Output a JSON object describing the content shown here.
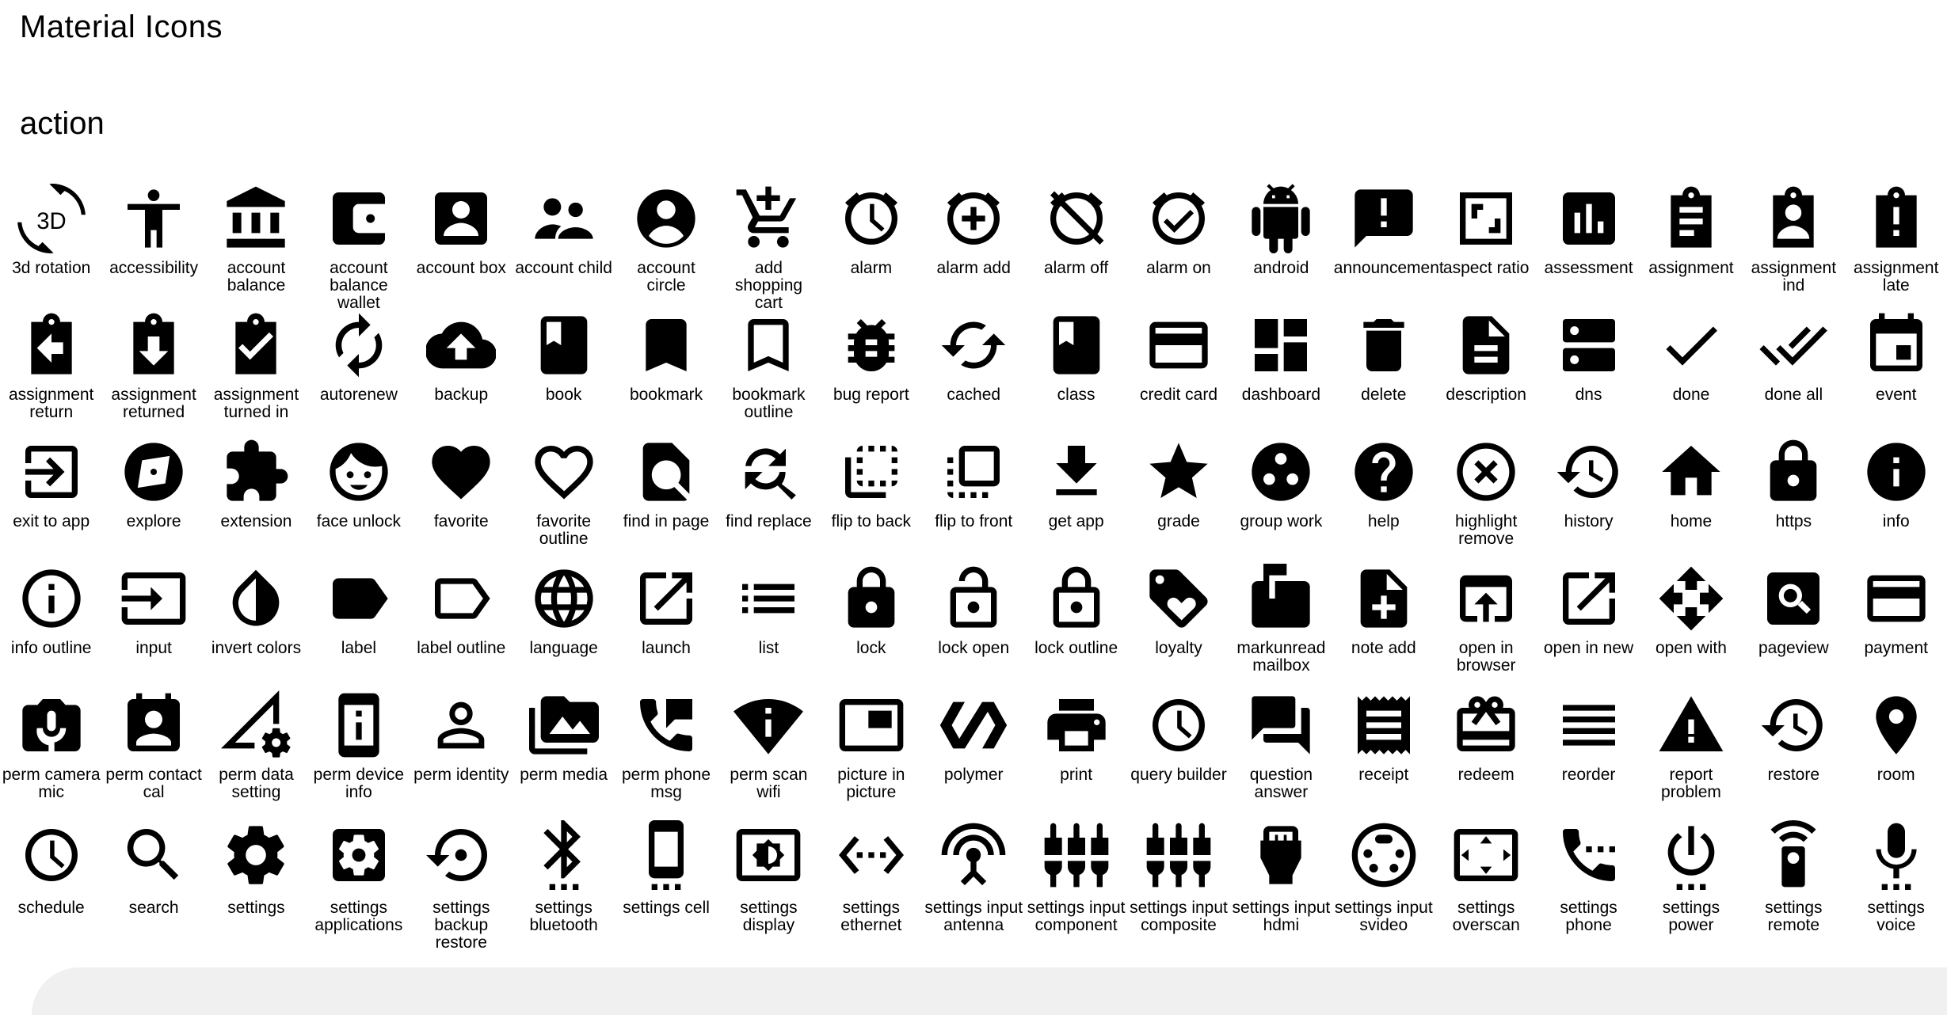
{
  "page_title": "Material Icons",
  "section": {
    "title": "action",
    "icons": [
      {
        "name": "3d rotation",
        "icon": "3d-rotation-icon"
      },
      {
        "name": "accessibility",
        "icon": "accessibility-icon"
      },
      {
        "name": "account balance",
        "icon": "account-balance-icon"
      },
      {
        "name": "account balance wallet",
        "icon": "account-balance-wallet-icon"
      },
      {
        "name": "account box",
        "icon": "account-box-icon"
      },
      {
        "name": "account child",
        "icon": "account-child-icon"
      },
      {
        "name": "account circle",
        "icon": "account-circle-icon"
      },
      {
        "name": "add shopping cart",
        "icon": "add-shopping-cart-icon"
      },
      {
        "name": "alarm",
        "icon": "alarm-icon"
      },
      {
        "name": "alarm add",
        "icon": "alarm-add-icon"
      },
      {
        "name": "alarm off",
        "icon": "alarm-off-icon"
      },
      {
        "name": "alarm on",
        "icon": "alarm-on-icon"
      },
      {
        "name": "android",
        "icon": "android-icon"
      },
      {
        "name": "announcement",
        "icon": "announcement-icon"
      },
      {
        "name": "aspect ratio",
        "icon": "aspect-ratio-icon"
      },
      {
        "name": "assessment",
        "icon": "assessment-icon"
      },
      {
        "name": "assignment",
        "icon": "assignment-icon"
      },
      {
        "name": "assignment ind",
        "icon": "assignment-ind-icon"
      },
      {
        "name": "assignment late",
        "icon": "assignment-late-icon"
      },
      {
        "name": "assignment return",
        "icon": "assignment-return-icon"
      },
      {
        "name": "assignment returned",
        "icon": "assignment-returned-icon"
      },
      {
        "name": "assignment turned in",
        "icon": "assignment-turned-in-icon"
      },
      {
        "name": "autorenew",
        "icon": "autorenew-icon"
      },
      {
        "name": "backup",
        "icon": "backup-icon"
      },
      {
        "name": "book",
        "icon": "book-icon"
      },
      {
        "name": "bookmark",
        "icon": "bookmark-icon"
      },
      {
        "name": "bookmark outline",
        "icon": "bookmark-outline-icon"
      },
      {
        "name": "bug report",
        "icon": "bug-report-icon"
      },
      {
        "name": "cached",
        "icon": "cached-icon"
      },
      {
        "name": "class",
        "icon": "class-icon"
      },
      {
        "name": "credit card",
        "icon": "credit-card-icon"
      },
      {
        "name": "dashboard",
        "icon": "dashboard-icon"
      },
      {
        "name": "delete",
        "icon": "delete-icon"
      },
      {
        "name": "description",
        "icon": "description-icon"
      },
      {
        "name": "dns",
        "icon": "dns-icon"
      },
      {
        "name": "done",
        "icon": "done-icon"
      },
      {
        "name": "done all",
        "icon": "done-all-icon"
      },
      {
        "name": "event",
        "icon": "event-icon"
      },
      {
        "name": "exit to app",
        "icon": "exit-to-app-icon"
      },
      {
        "name": "explore",
        "icon": "explore-icon"
      },
      {
        "name": "extension",
        "icon": "extension-icon"
      },
      {
        "name": "face unlock",
        "icon": "face-unlock-icon"
      },
      {
        "name": "favorite",
        "icon": "favorite-icon"
      },
      {
        "name": "favorite outline",
        "icon": "favorite-outline-icon"
      },
      {
        "name": "find in page",
        "icon": "find-in-page-icon"
      },
      {
        "name": "find replace",
        "icon": "find-replace-icon"
      },
      {
        "name": "flip to back",
        "icon": "flip-to-back-icon"
      },
      {
        "name": "flip to front",
        "icon": "flip-to-front-icon"
      },
      {
        "name": "get app",
        "icon": "get-app-icon"
      },
      {
        "name": "grade",
        "icon": "grade-icon"
      },
      {
        "name": "group work",
        "icon": "group-work-icon"
      },
      {
        "name": "help",
        "icon": "help-icon"
      },
      {
        "name": "highlight remove",
        "icon": "highlight-remove-icon"
      },
      {
        "name": "history",
        "icon": "history-icon"
      },
      {
        "name": "home",
        "icon": "home-icon"
      },
      {
        "name": "https",
        "icon": "https-icon"
      },
      {
        "name": "info",
        "icon": "info-icon"
      },
      {
        "name": "info outline",
        "icon": "info-outline-icon"
      },
      {
        "name": "input",
        "icon": "input-icon"
      },
      {
        "name": "invert colors",
        "icon": "invert-colors-icon"
      },
      {
        "name": "label",
        "icon": "label-icon"
      },
      {
        "name": "label outline",
        "icon": "label-outline-icon"
      },
      {
        "name": "language",
        "icon": "language-icon"
      },
      {
        "name": "launch",
        "icon": "launch-icon"
      },
      {
        "name": "list",
        "icon": "list-icon"
      },
      {
        "name": "lock",
        "icon": "lock-icon"
      },
      {
        "name": "lock open",
        "icon": "lock-open-icon"
      },
      {
        "name": "lock outline",
        "icon": "lock-outline-icon"
      },
      {
        "name": "loyalty",
        "icon": "loyalty-icon"
      },
      {
        "name": "markunread mailbox",
        "icon": "markunread-mailbox-icon"
      },
      {
        "name": "note add",
        "icon": "note-add-icon"
      },
      {
        "name": "open in browser",
        "icon": "open-in-browser-icon"
      },
      {
        "name": "open in new",
        "icon": "open-in-new-icon"
      },
      {
        "name": "open with",
        "icon": "open-with-icon"
      },
      {
        "name": "pageview",
        "icon": "pageview-icon"
      },
      {
        "name": "payment",
        "icon": "payment-icon"
      },
      {
        "name": "perm camera mic",
        "icon": "perm-camera-mic-icon"
      },
      {
        "name": "perm contact cal",
        "icon": "perm-contact-cal-icon"
      },
      {
        "name": "perm data setting",
        "icon": "perm-data-setting-icon"
      },
      {
        "name": "perm device info",
        "icon": "perm-device-info-icon"
      },
      {
        "name": "perm identity",
        "icon": "perm-identity-icon"
      },
      {
        "name": "perm media",
        "icon": "perm-media-icon"
      },
      {
        "name": "perm phone msg",
        "icon": "perm-phone-msg-icon"
      },
      {
        "name": "perm scan wifi",
        "icon": "perm-scan-wifi-icon"
      },
      {
        "name": "picture in picture",
        "icon": "picture-in-picture-icon"
      },
      {
        "name": "polymer",
        "icon": "polymer-icon"
      },
      {
        "name": "print",
        "icon": "print-icon"
      },
      {
        "name": "query builder",
        "icon": "query-builder-icon"
      },
      {
        "name": "question answer",
        "icon": "question-answer-icon"
      },
      {
        "name": "receipt",
        "icon": "receipt-icon"
      },
      {
        "name": "redeem",
        "icon": "redeem-icon"
      },
      {
        "name": "reorder",
        "icon": "reorder-icon"
      },
      {
        "name": "report problem",
        "icon": "report-problem-icon"
      },
      {
        "name": "restore",
        "icon": "restore-icon"
      },
      {
        "name": "room",
        "icon": "room-icon"
      },
      {
        "name": "schedule",
        "icon": "schedule-icon"
      },
      {
        "name": "search",
        "icon": "search-icon"
      },
      {
        "name": "settings",
        "icon": "settings-icon"
      },
      {
        "name": "settings applications",
        "icon": "settings-applications-icon"
      },
      {
        "name": "settings backup restore",
        "icon": "settings-backup-restore-icon"
      },
      {
        "name": "settings bluetooth",
        "icon": "settings-bluetooth-icon"
      },
      {
        "name": "settings cell",
        "icon": "settings-cell-icon"
      },
      {
        "name": "settings display",
        "icon": "settings-display-icon"
      },
      {
        "name": "settings ethernet",
        "icon": "settings-ethernet-icon"
      },
      {
        "name": "settings input antenna",
        "icon": "settings-input-antenna-icon"
      },
      {
        "name": "settings input component",
        "icon": "settings-input-component-icon"
      },
      {
        "name": "settings input composite",
        "icon": "settings-input-composite-icon"
      },
      {
        "name": "settings input hdmi",
        "icon": "settings-input-hdmi-icon"
      },
      {
        "name": "settings input svideo",
        "icon": "settings-input-svideo-icon"
      },
      {
        "name": "settings overscan",
        "icon": "settings-overscan-icon"
      },
      {
        "name": "settings phone",
        "icon": "settings-phone-icon"
      },
      {
        "name": "settings power",
        "icon": "settings-power-icon"
      },
      {
        "name": "settings remote",
        "icon": "settings-remote-icon"
      },
      {
        "name": "settings voice",
        "icon": "settings-voice-icon"
      }
    ]
  }
}
